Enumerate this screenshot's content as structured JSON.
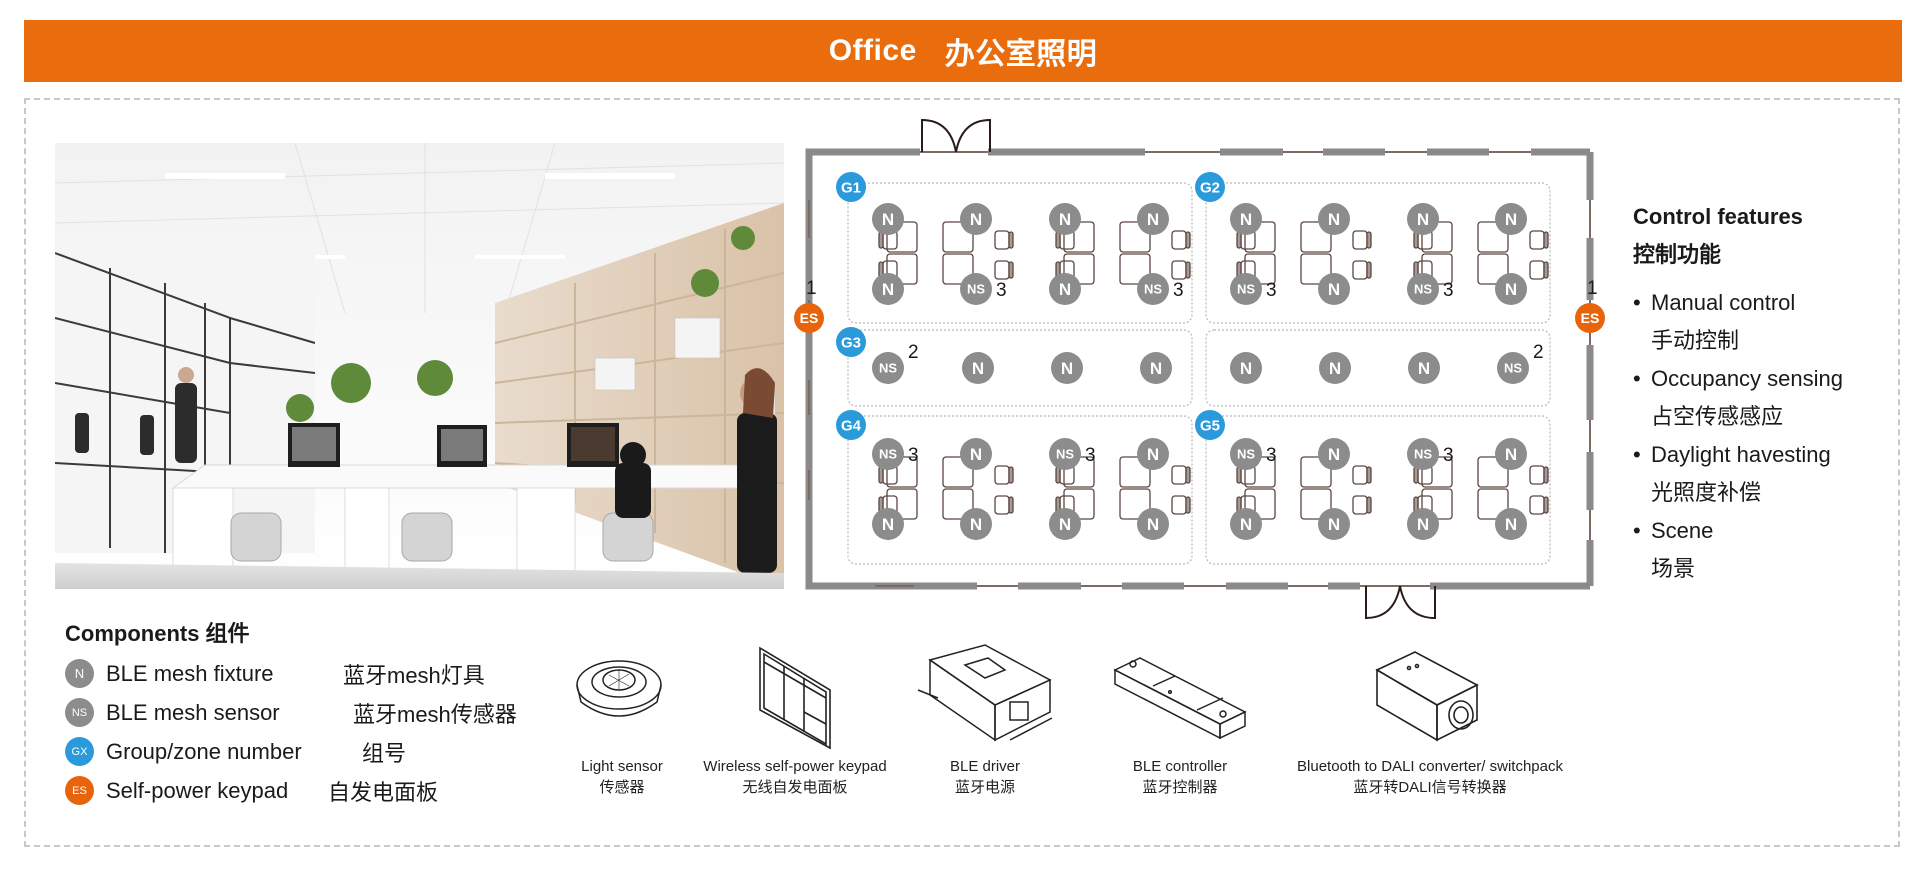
{
  "header": {
    "title_en": "Office",
    "title_zh": "办公室照明",
    "color": "#E96D0C"
  },
  "photo": {
    "description": "Office interior rendering with desks, monitors and bookshelves"
  },
  "floor_plan": {
    "marker_colors": {
      "N": "#8c8c8c",
      "NS": "#8c8c8c",
      "G": "#2a9adb",
      "ES": "#e8640c"
    },
    "groups": [
      {
        "label": "G1",
        "desk_clusters": [
          {
            "markers": [
              "N",
              "N",
              "N",
              "NS"
            ],
            "sensor_count": "3"
          },
          {
            "markers": [
              "N",
              "N",
              "N",
              "NS"
            ],
            "sensor_count": "3"
          }
        ]
      },
      {
        "label": "G2",
        "desk_clusters": [
          {
            "markers": [
              "N",
              "N",
              "NS",
              "N"
            ],
            "sensor_count": "3"
          },
          {
            "markers": [
              "N",
              "N",
              "NS",
              "N"
            ],
            "sensor_count": "3"
          }
        ]
      },
      {
        "label": "G3",
        "corridor_left": {
          "markers": [
            "NS",
            "N",
            "N",
            "N"
          ],
          "sensor_count": "2"
        },
        "corridor_right": {
          "markers": [
            "N",
            "N",
            "N",
            "NS"
          ],
          "sensor_count": "2"
        }
      },
      {
        "label": "G4",
        "desk_clusters": [
          {
            "markers": [
              "NS",
              "N",
              "N",
              "N"
            ],
            "sensor_count": "3"
          },
          {
            "markers": [
              "NS",
              "N",
              "N",
              "N"
            ],
            "sensor_count": "3"
          }
        ]
      },
      {
        "label": "G5",
        "desk_clusters": [
          {
            "markers": [
              "NS",
              "N",
              "N",
              "N"
            ],
            "sensor_count": "3"
          },
          {
            "markers": [
              "NS",
              "N",
              "N",
              "N"
            ],
            "sensor_count": "3"
          }
        ]
      }
    ],
    "keypads": [
      {
        "label": "ES",
        "count": "1",
        "side": "left"
      },
      {
        "label": "ES",
        "count": "1",
        "side": "right"
      }
    ]
  },
  "controls": {
    "title_en": "Control features",
    "title_zh": "控制功能",
    "items": [
      {
        "en": "Manual control",
        "zh": "手动控制"
      },
      {
        "en": "Occupancy sensing",
        "zh": "占空传感感应"
      },
      {
        "en": "Daylight havesting",
        "zh": "光照度补偿"
      },
      {
        "en": "Scene",
        "zh": "场景"
      }
    ]
  },
  "components": {
    "title": "Components 组件",
    "items": [
      {
        "badge": "N",
        "en": "BLE mesh fixture",
        "zh": "蓝牙mesh灯具",
        "color": "#8c8c8c"
      },
      {
        "badge": "NS",
        "en": "BLE mesh sensor",
        "zh": "蓝牙mesh传感器",
        "color": "#8c8c8c"
      },
      {
        "badge": "GX",
        "en": "Group/zone number",
        "zh": "组号",
        "color": "#2a9adb"
      },
      {
        "badge": "ES",
        "en": "Self-power keypad",
        "zh": "自发电面板",
        "color": "#e8640c"
      }
    ]
  },
  "products": [
    {
      "icon": "light-sensor-icon",
      "en": "Light sensor",
      "zh": "传感器"
    },
    {
      "icon": "keypad-icon",
      "en": "Wireless self-power keypad",
      "zh": "无线自发电面板"
    },
    {
      "icon": "ble-driver-icon",
      "en": "BLE driver",
      "zh": "蓝牙电源"
    },
    {
      "icon": "ble-controller-icon",
      "en": "BLE controller",
      "zh": "蓝牙控制器"
    },
    {
      "icon": "dali-converter-icon",
      "en": "Bluetooth to DALI converter/ switchpack",
      "zh": "蓝牙转DALI信号转换器"
    }
  ]
}
